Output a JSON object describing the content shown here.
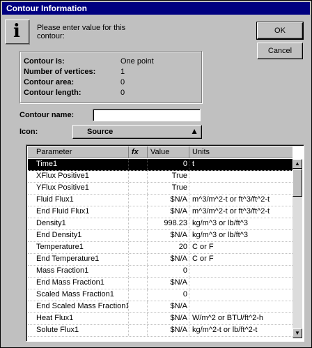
{
  "window": {
    "title": "Contour Information"
  },
  "prompt": {
    "text": "Please enter value for this contour:"
  },
  "buttons": {
    "ok": "OK",
    "cancel": "Cancel"
  },
  "summary": {
    "items": [
      {
        "label": "Contour is:",
        "value": "One point"
      },
      {
        "label": "Number of vertices:",
        "value": "1"
      },
      {
        "label": "Contour area:",
        "value": "0"
      },
      {
        "label": "Contour length:",
        "value": "0"
      }
    ]
  },
  "name_field": {
    "label": "Contour name:",
    "value": ""
  },
  "icon_field": {
    "label": "Icon:",
    "value": "Source"
  },
  "grid": {
    "columns": {
      "parameter": "Parameter",
      "fx": "fx",
      "value": "Value",
      "units": "Units"
    },
    "rows": [
      {
        "parameter": "Time1",
        "value": "0",
        "units": "t"
      },
      {
        "parameter": "XFlux Positive1",
        "value": "True",
        "units": ""
      },
      {
        "parameter": "YFlux Positive1",
        "value": "True",
        "units": ""
      },
      {
        "parameter": "Fluid Flux1",
        "value": "$N/A",
        "units": "m^3/m^2-t or ft^3/ft^2-t"
      },
      {
        "parameter": "End Fluid Flux1",
        "value": "$N/A",
        "units": "m^3/m^2-t or ft^3/ft^2-t"
      },
      {
        "parameter": "Density1",
        "value": "998.23",
        "units": "kg/m^3 or lb/ft^3"
      },
      {
        "parameter": "End Density1",
        "value": "$N/A",
        "units": "kg/m^3 or lb/ft^3"
      },
      {
        "parameter": "Temperature1",
        "value": "20",
        "units": "C or F"
      },
      {
        "parameter": "End Temperature1",
        "value": "$N/A",
        "units": "C or F"
      },
      {
        "parameter": "Mass Fraction1",
        "value": "0",
        "units": ""
      },
      {
        "parameter": "End Mass Fraction1",
        "value": "$N/A",
        "units": ""
      },
      {
        "parameter": "Scaled Mass Fraction1",
        "value": "0",
        "units": ""
      },
      {
        "parameter": "End Scaled Mass Fraction1",
        "value": "$N/A",
        "units": ""
      },
      {
        "parameter": "Heat Flux1",
        "value": "$N/A",
        "units": "W/m^2 or BTU/ft^2-h"
      },
      {
        "parameter": "Solute Flux1",
        "value": "$N/A",
        "units": "kg/m^2-t or lb/ft^2-t"
      }
    ]
  }
}
